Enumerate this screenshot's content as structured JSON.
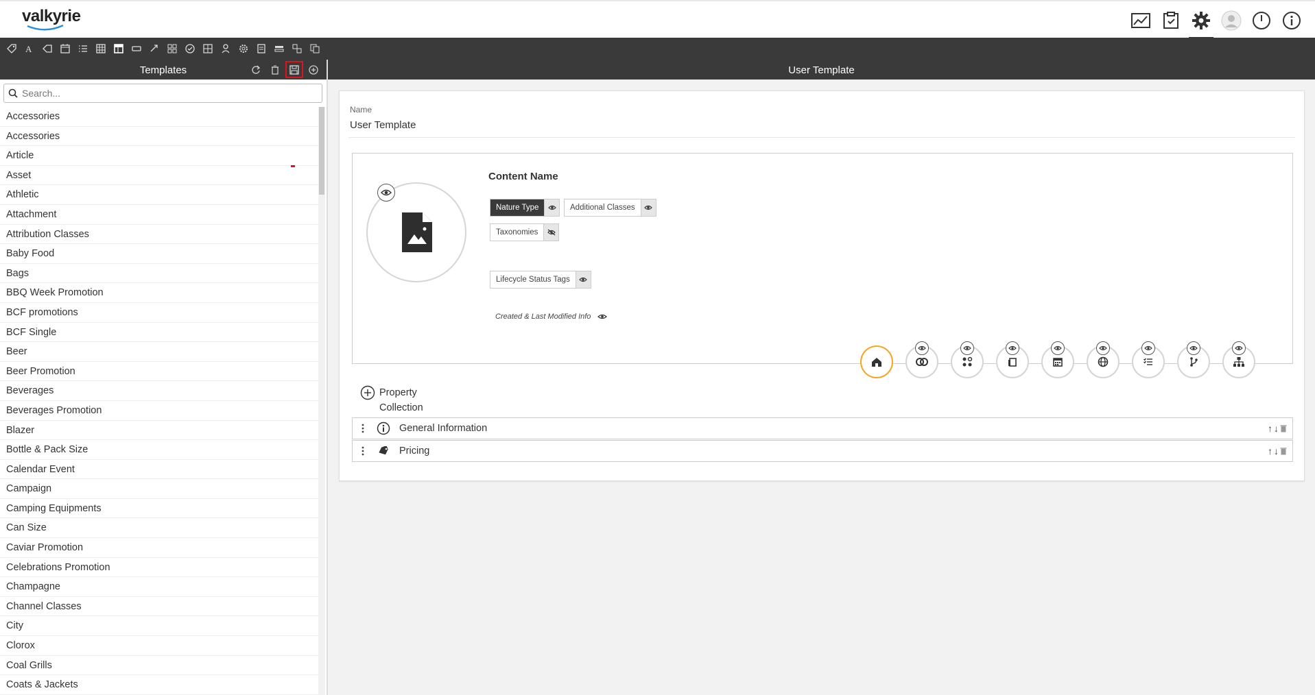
{
  "app": {
    "logo": "valkyrie"
  },
  "header": {
    "icons": [
      "dashboard-icon",
      "tasks-icon",
      "settings-icon",
      "user-icon",
      "power-icon",
      "info-icon"
    ],
    "active": "settings-icon"
  },
  "left_panel": {
    "title": "Templates",
    "search_placeholder": "Search...",
    "items": [
      "Accessories",
      "Accessories",
      "Article",
      "Asset",
      "Athletic",
      "Attachment",
      "Attribution Classes",
      "Baby Food",
      "Bags",
      "BBQ Week Promotion",
      "BCF promotions",
      "BCF Single",
      "Beer",
      "Beer Promotion",
      "Beverages",
      "Beverages Promotion",
      "Blazer",
      "Bottle & Pack Size",
      "Calendar Event",
      "Campaign",
      "Camping Equipments",
      "Can Size",
      "Caviar Promotion",
      "Celebrations Promotion",
      "Champagne",
      "Channel Classes",
      "City",
      "Clorox",
      "Coal Grills",
      "Coats & Jackets"
    ]
  },
  "right_panel": {
    "title": "User Template",
    "name_label": "Name",
    "name_value": "User Template",
    "content_name": "Content Name",
    "chips": {
      "nature_type": "Nature Type",
      "additional_classes": "Additional Classes",
      "taxonomies": "Taxonomies",
      "lifecycle": "Lifecycle Status Tags"
    },
    "created_info": "Created & Last Modified Info",
    "add_property": {
      "line1": "Property",
      "line2": "Collection"
    },
    "sections": [
      {
        "label": "General Information",
        "icon": "info-icon"
      },
      {
        "label": "Pricing",
        "icon": "tag-icon"
      }
    ]
  },
  "colors": {
    "accent": "#f5a623",
    "dark_bar": "#3a3a3a",
    "highlight": "#e0121c"
  }
}
